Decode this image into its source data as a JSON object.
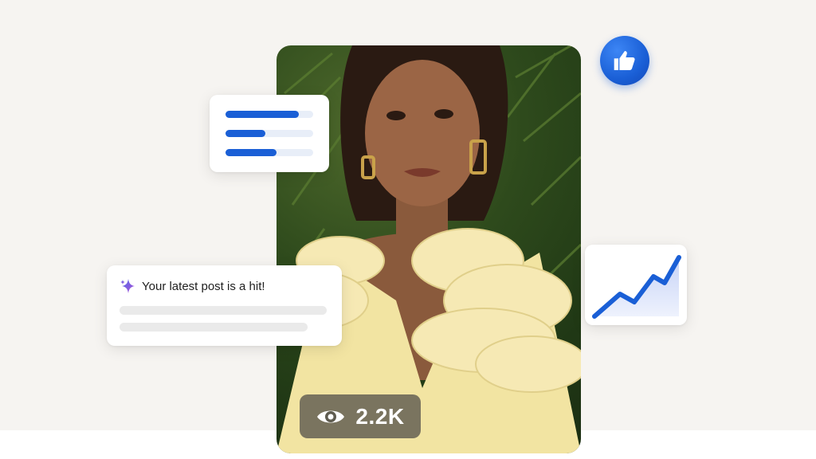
{
  "notification": {
    "title": "Your latest post is a hit!",
    "icon": "sparkle-icon"
  },
  "views_badge": {
    "count": "2.2K",
    "icon": "eye-icon"
  },
  "like_badge": {
    "icon": "thumbs-up-icon"
  },
  "text_card": {
    "icon": "text-lines-icon"
  },
  "trend_card": {
    "icon": "trend-chart-icon"
  },
  "photo": {
    "subject": "portrait-photo"
  },
  "colors": {
    "accent_blue": "#1a5fd6",
    "background": "#f6f4f1",
    "dress_yellow": "#f5e8a8"
  }
}
